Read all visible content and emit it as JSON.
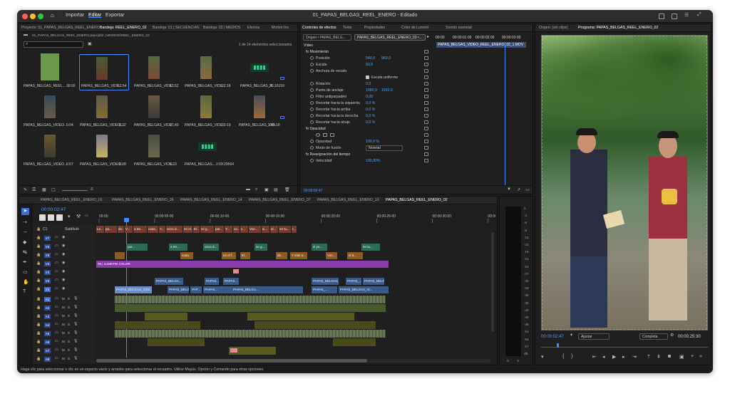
{
  "window": {
    "title": "01_PAPAS_BELGAS_REEL_ENERO - Editado",
    "menu": [
      "Importar",
      "Editar",
      "Exportar"
    ],
    "active_menu": "Editar"
  },
  "project_panel": {
    "tabs": [
      "Proyecto: 01_PAPAS_BELGAS_REEL_ENERO",
      "Bandeja: REEL_ENERO_02",
      "Bandeja: 01 | SECUENCIAS",
      "Bandeja: 02 | MEDIOS",
      "Efectos",
      "Motion Ins"
    ],
    "active_tab": 1,
    "path": "01_PAPAS_BELGAS_REEL_ENERO.prproj\\02 | MEDIOS\\REEL_ENERO_02",
    "search_placeholder": "",
    "selection_count": "1 de 14 elementos seleccionados",
    "items": [
      {
        "name": "PAPAS_BELGAS_REEL...",
        "duration": "30:00"
      },
      {
        "name": "PAPAS_BELGAS_VIDE...",
        "duration": "12:54"
      },
      {
        "name": "PAPAS_BELGAS_VIDE...",
        "duration": "12:52"
      },
      {
        "name": "PAPAS_BELGAS_VIDE...",
        "duration": "22:18"
      },
      {
        "name": "PAPAS_BELGAS_R...",
        "duration": "25:16159"
      },
      {
        "name": "PAPAS_BELGAS_VIDEO...",
        "duration": "5:04"
      },
      {
        "name": "PAPAS_BELGAS_VIDEO...",
        "duration": "6:32"
      },
      {
        "name": "PAPAS_BELGAS_VIDE...",
        "duration": "27:40"
      },
      {
        "name": "PAPAS_BELGAS_VIDE...",
        "duration": "20:19"
      },
      {
        "name": "PAPAS_BELGAS_VID...",
        "duration": "1:46:18"
      },
      {
        "name": "PAPAS_BELGAS_VIDEO...",
        "duration": "6:07"
      },
      {
        "name": "PAPAS_BELGAS_VIDEO...",
        "duration": "6:08"
      },
      {
        "name": "PAPAS_BELGAS_VIDE...",
        "duration": "6:23"
      },
      {
        "name": "PAPAS_BELGAS...",
        "duration": "2:09:29564"
      }
    ]
  },
  "effect_controls": {
    "tabs": [
      "Controles de efectos",
      "Texto",
      "Propiedades",
      "Color de Lumetri",
      "Sonido esencial"
    ],
    "source_dropdown": "Origen • PAPAS_BELG...",
    "sequence_dropdown": "PAPAS_BELGAS_REEL_ENERO_03 •...",
    "timecodes": [
      "00:00",
      "00:00:01:00",
      "00:00:02:00",
      "00:00:03:00"
    ],
    "clip_label": "PAPAS_BELGAS_VIDEO_REEL_ENERO_02_1.MOV",
    "section_video": "Vídeo",
    "rows": [
      {
        "label": "fx  Movimiento",
        "value": "",
        "value2": ""
      },
      {
        "label": "Posición",
        "value": "540,0",
        "value2": "960,0"
      },
      {
        "label": "Escala",
        "value": "50,0",
        "value2": ""
      },
      {
        "label": "Anchura de escala",
        "value": "",
        "value2": ""
      },
      {
        "label": "Escala uniforme",
        "value": "",
        "value2": ""
      },
      {
        "label": "Rotación",
        "value": "0,0",
        "value2": ""
      },
      {
        "label": "Punto de anclaje",
        "value": "1080,0",
        "value2": "1920,0"
      },
      {
        "label": "Filtro antiparpadeo",
        "value": "0,00",
        "value2": ""
      },
      {
        "label": "Recortar hacia la izquierda",
        "value": "0,0 %",
        "value2": ""
      },
      {
        "label": "Recortar hacia arriba",
        "value": "0,0 %",
        "value2": ""
      },
      {
        "label": "Recortar hacia la derecha",
        "value": "0,0 %",
        "value2": ""
      },
      {
        "label": "Recortar hacia abajo",
        "value": "0,0 %",
        "value2": ""
      },
      {
        "label": "fx  Opacidad",
        "value": "",
        "value2": ""
      },
      {
        "label": "",
        "value": "",
        "value2": ""
      },
      {
        "label": "Opacidad",
        "value": "100,0 %",
        "value2": ""
      },
      {
        "label": "Modo de fusión",
        "value": "Normal",
        "value2": ""
      },
      {
        "label": "fx  Reasignación del tiempo",
        "value": "",
        "value2": ""
      },
      {
        "label": "Velocidad",
        "value": "100,00%",
        "value2": ""
      }
    ],
    "current_time": "00:00:02:47"
  },
  "program_monitor": {
    "tabs": [
      "Origen: (sin clips)",
      "Programa: PAPAS_BELGAS_REEL_ENERO_02"
    ],
    "timecode": "00:00:02:47",
    "fit": "Ajustar",
    "quality": "Completa",
    "duration": "00:00:25:30"
  },
  "timeline": {
    "tabs": [
      "PAPAS_BELGAS_REEL_ENERO_01",
      "PAPAS_BELGAS_REEL_ENERO_26",
      "PAPAS_BELGAS_REEL_ENERO_14",
      "PAPAS_BELGAS_REEL_ENERO_07",
      "PAPAS_BELGAS_REEL_ENERO_10",
      "PAPAS_BELGAS_REEL_ENERO_02"
    ],
    "active_tab": 5,
    "timecode": "00:00:02:47",
    "ruler": [
      "00:00",
      "00:00:05:00",
      "00:00:10:00",
      "00:00:15:00",
      "00:00:20:00",
      "00:00:25:00",
      "00:00:30:00",
      "00:00:35:00"
    ],
    "subtitle_track": "C1",
    "subtitle_label": "Subtítulo",
    "subtitle_clips": [
      "Le...",
      "pa...",
      "de...",
      "V...",
      "a tre...",
      "cada...",
      "V...",
      "unos d...",
      "en el...",
      "El...",
      "se g...",
      "par...",
      "Y...",
      "co...",
      "s...",
      "Vos...",
      "si...",
      "el...",
      "en tu...",
      "t..."
    ],
    "video_tracks": [
      "V7",
      "V6",
      "V5",
      "V4",
      "V3",
      "V2",
      "V1"
    ],
    "audio_tracks": [
      "A1",
      "A2",
      "A3",
      "A4",
      "A5",
      "A6",
      "A7",
      "A8"
    ],
    "v6_clips": [
      "par...",
      "a tre...",
      "unos d...",
      "se g...",
      "si yo...",
      "en tu..."
    ],
    "v5_clips": [
      "cada...",
      "en el f...",
      "El...",
      "de...",
      "Y este a...",
      "Vos...",
      "el d..."
    ],
    "v4_label": "05 | LUMETRI COLOR",
    "v2_clips": [
      "PAPAS_BELGA...",
      "PAPAS...",
      "PAPAS...",
      "PAPAS_BELGAS_VI...",
      "PAPAS_...",
      "PAPAS_BELGA..."
    ],
    "v1_clips": [
      "PAPAS_BELGAS_VIDE...",
      "PAPAS_BELG...",
      "PAP...",
      "PAPAS...",
      "PAPAS_BELGA...",
      "PAPAS_...",
      "PAPAS_BELGAS_VI..."
    ]
  },
  "meter_scale": [
    "0",
    "-3",
    "-6",
    "-9",
    "-12",
    "-15",
    "-18",
    "-21",
    "-24",
    "-27",
    "-30",
    "-33",
    "-36",
    "-39",
    "-42",
    "-45",
    "-48",
    "-51",
    "-54",
    "-57",
    "dB"
  ],
  "status_bar": "Haga clic para seleccionar o clic en un espacio vacío y arrastre para seleccionar el recuadro. Utilice Mayús, Opción y Comando para otras opciones."
}
